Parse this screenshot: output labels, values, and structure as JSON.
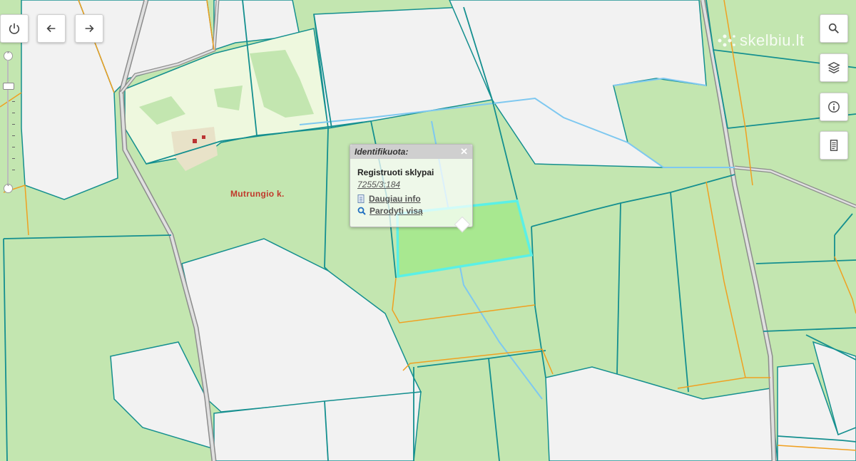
{
  "toolbar": {
    "power_label": "power",
    "back_label": "back",
    "forward_label": "forward"
  },
  "right_tools": [
    "search",
    "layers",
    "info",
    "document"
  ],
  "watermark": {
    "text": "skelbiu.lt"
  },
  "map": {
    "village_label": "Mutrungio k."
  },
  "popup": {
    "title": "Identifikuota:",
    "close": "✕",
    "layer": "Registruoti sklypai",
    "parcel_id": "7255/3:184",
    "more_info": "Daugiau info",
    "show_all": "Parodyti visą"
  },
  "colors": {
    "green": "#c3e6b0",
    "light_green": "#eef8de",
    "white_area": "#f2f2f2",
    "teal_border": "#148f8f",
    "orange_border": "#f0a020",
    "road": "#e0e0e0",
    "selected": "#5af0e6",
    "water": "#7ec8f0"
  }
}
